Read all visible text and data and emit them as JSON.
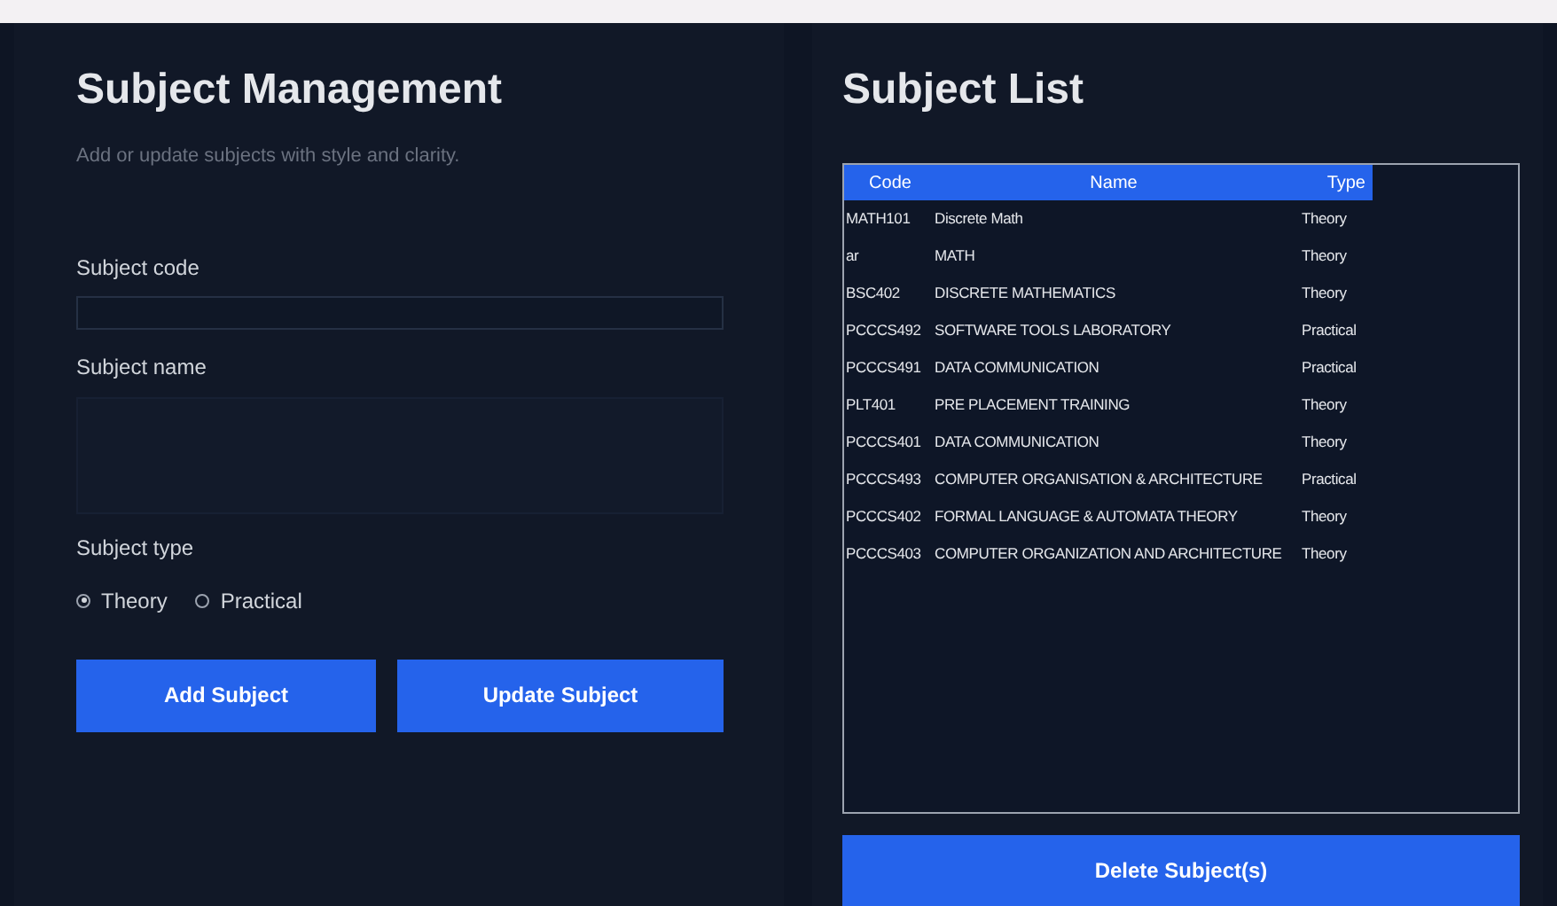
{
  "form": {
    "title": "Subject Management",
    "subtitle": "Add or update subjects with style and clarity.",
    "code_label": "Subject code",
    "name_label": "Subject name",
    "type_label": "Subject type",
    "types": [
      {
        "label": "Theory",
        "selected": true
      },
      {
        "label": "Practical",
        "selected": false
      }
    ],
    "buttons": [
      "Add Subject",
      "Update Subject"
    ]
  },
  "list": {
    "title": "Subject List",
    "columns": [
      "Code",
      "Name",
      "Type"
    ],
    "rows": [
      [
        "MATH101",
        "Discrete Math",
        "Theory"
      ],
      [
        "ar",
        "MATH",
        "Theory"
      ],
      [
        "BSC402",
        "DISCRETE MATHEMATICS",
        "Theory"
      ],
      [
        "PCCCS492",
        "SOFTWARE TOOLS LABORATORY",
        "Practical"
      ],
      [
        "PCCCS491",
        "DATA COMMUNICATION",
        "Practical"
      ],
      [
        "PLT401",
        "PRE PLACEMENT TRAINING",
        "Theory"
      ],
      [
        "PCCCS401",
        "DATA COMMUNICATION",
        "Theory"
      ],
      [
        "PCCCS493",
        "COMPUTER ORGANISATION & ARCHITECTURE",
        "Practical"
      ],
      [
        "PCCCS402",
        "FORMAL LANGUAGE & AUTOMATA THEORY",
        "Theory"
      ],
      [
        "PCCCS403",
        "COMPUTER ORGANIZATION AND ARCHITECTURE",
        "Theory"
      ]
    ],
    "delete_button": "Delete Subject(s)"
  }
}
